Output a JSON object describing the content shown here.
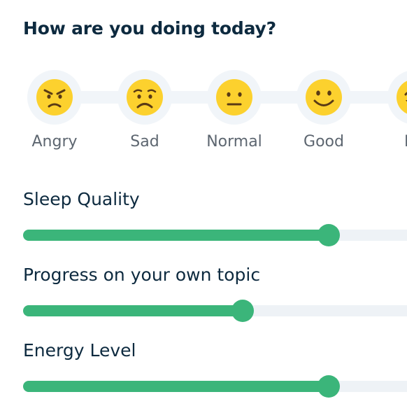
{
  "question": "How are you doing today?",
  "moods": [
    {
      "label": "Angry",
      "icon": "angry-face-icon"
    },
    {
      "label": "Sad",
      "icon": "sad-face-icon"
    },
    {
      "label": "Normal",
      "icon": "neutral-face-icon"
    },
    {
      "label": "Good",
      "icon": "smiling-face-icon"
    },
    {
      "label": "Ha",
      "icon": "happy-face-icon"
    }
  ],
  "sliders": [
    {
      "label": "Sleep Quality",
      "value": 0.78
    },
    {
      "label": "Progress on your own topic",
      "value": 0.56
    },
    {
      "label": "Energy Level",
      "value": 0.78
    }
  ],
  "colors": {
    "accent": "#3bb57a",
    "title": "#0d2a3f",
    "emoji": "#fcd12e"
  }
}
